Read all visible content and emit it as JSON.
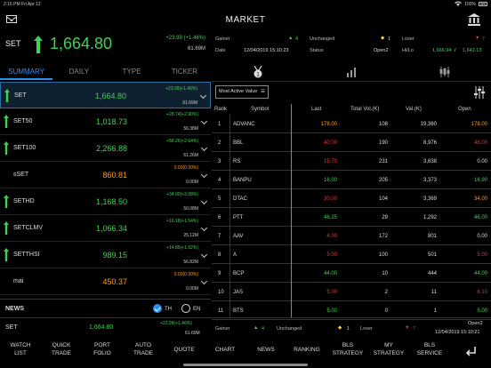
{
  "statusbar": {
    "time": "2:16 PM",
    "date": "Fri Apr 12",
    "battery": "100%"
  },
  "header": {
    "title": "MARKET"
  },
  "index": {
    "name": "SET",
    "value": "1,664.80",
    "change": "+23.99 (+1.46%)",
    "volume": "61.69M"
  },
  "stats": {
    "gainer_label": "Gainer",
    "gainer_val": "4",
    "unchanged_label": "Unchanged",
    "unchanged_val": "1",
    "loser_label": "Loser",
    "loser_val": "7",
    "date_label": "Date",
    "date_val": "12/04/2019 15:10:23",
    "status_label": "Status",
    "status_val": "Open2",
    "hilo_label": "Hi/Lo",
    "hi_val": "1,666.94",
    "lo_val": "1,642.13"
  },
  "tabs": [
    "SUMMARY",
    "DAILY",
    "TYPE",
    "TICKER"
  ],
  "indices": [
    {
      "name": "SET",
      "last": "1,664.80",
      "chg": "+23.99(+1.46%)",
      "vol": "61.69M",
      "color": "green",
      "arrow": "up"
    },
    {
      "name": "SET50",
      "last": "1,018.73",
      "chg": "+28.74(+2.90%)",
      "vol": "56.38M",
      "color": "green",
      "arrow": "up"
    },
    {
      "name": "SET100",
      "last": "2,266.88",
      "chg": "+58.26(+2.64%)",
      "vol": "61.26M",
      "color": "green",
      "arrow": "up"
    },
    {
      "name": "sSET",
      "last": "860.81",
      "chg": "0.00(0.00%)",
      "vol": "0.00M",
      "color": "orange",
      "arrow": "none"
    },
    {
      "name": "SETHD",
      "last": "1,168.50",
      "chg": "+34.90(+3.08%)",
      "vol": "50.08M",
      "color": "green",
      "arrow": "up"
    },
    {
      "name": "SETCLMV",
      "last": "1,066.34",
      "chg": "+16.18(+1.54%)",
      "vol": "25.12M",
      "color": "green",
      "arrow": "up"
    },
    {
      "name": "SETTHSI",
      "last": "989.15",
      "chg": "+14.85(+1.52%)",
      "vol": "56.82M",
      "color": "green",
      "arrow": "up"
    },
    {
      "name": "mai",
      "last": "450.37",
      "chg": "0.00(0.00%)",
      "vol": "0.00M",
      "color": "orange",
      "arrow": "none"
    }
  ],
  "news": {
    "label": "NEWS",
    "opt1": "TH",
    "opt2": "EN"
  },
  "sort": {
    "label": "Most Active Value"
  },
  "table": {
    "headers": [
      "Rank",
      "Symbol",
      "Last",
      "Total Vol.(K)",
      "Val.(K)",
      "Open"
    ],
    "rows": [
      {
        "rank": "1",
        "symbol": "ADVANC",
        "last": "178.00",
        "vol": "108",
        "val": "19,360",
        "open": "178.00",
        "c": "orange",
        "oc": "orange"
      },
      {
        "rank": "2",
        "symbol": "BBL",
        "last": "40.00",
        "vol": "190",
        "val": "8,976",
        "open": "48.00",
        "c": "red",
        "oc": "red"
      },
      {
        "rank": "3",
        "symbol": "RS",
        "last": "15.70",
        "vol": "231",
        "val": "3,638",
        "open": "0.00",
        "c": "red",
        "oc": "white"
      },
      {
        "rank": "4",
        "symbol": "BANPU",
        "last": "16.00",
        "vol": "205",
        "val": "3,373",
        "open": "16.90",
        "c": "green",
        "oc": "green"
      },
      {
        "rank": "5",
        "symbol": "DTAC",
        "last": "30.00",
        "vol": "104",
        "val": "3,369",
        "open": "34.00",
        "c": "red",
        "oc": "orange"
      },
      {
        "rank": "6",
        "symbol": "PTT",
        "last": "46.25",
        "vol": "29",
        "val": "1,292",
        "open": "46.00",
        "c": "green",
        "oc": "green"
      },
      {
        "rank": "7",
        "symbol": "AAV",
        "last": "4.00",
        "vol": "172",
        "val": "801",
        "open": "0.00",
        "c": "red",
        "oc": "white"
      },
      {
        "rank": "8",
        "symbol": "A",
        "last": "5.00",
        "vol": "100",
        "val": "501",
        "open": "5.00",
        "c": "red",
        "oc": "red"
      },
      {
        "rank": "9",
        "symbol": "BCP",
        "last": "44.00",
        "vol": "10",
        "val": "444",
        "open": "44.00",
        "c": "green",
        "oc": "green"
      },
      {
        "rank": "10",
        "symbol": "JAS",
        "last": "5.00",
        "vol": "2",
        "val": "11",
        "open": "6.10",
        "c": "red",
        "oc": "red"
      },
      {
        "rank": "11",
        "symbol": "BTS",
        "last": "5.00",
        "vol": "0",
        "val": "1",
        "open": "5.00",
        "c": "green",
        "oc": "green"
      }
    ]
  },
  "footer": {
    "name": "SET",
    "last": "1,664.80",
    "chg": "+23.99(+1.46%)",
    "vol": "61.69M",
    "gainer_label": "Gainer",
    "gainer_val": "4",
    "unchanged_label": "Unchanged",
    "unchanged_val": "1",
    "loser_label": "Loser",
    "loser_val": "7",
    "status_val": "Open2",
    "date_val": "12/04/2019 15:10:21"
  },
  "nav": [
    [
      "WATCH",
      "LIST"
    ],
    [
      "QUICK",
      "TRADE"
    ],
    [
      "PORT",
      "FOLIO"
    ],
    [
      "AUTO",
      "TRADE"
    ],
    [
      "QUOTE"
    ],
    [
      "CHART"
    ],
    [
      "NEWS"
    ],
    [
      "RANKING"
    ],
    [
      "BLS",
      "STRATEGY"
    ],
    [
      "MY",
      "STRATEGY"
    ],
    [
      "BLS",
      "SERVICE"
    ]
  ],
  "colors": {
    "green": "#3fd34f",
    "red": "#e03a3a",
    "orange": "#ff9c1a",
    "accent": "#2c8ff0"
  }
}
